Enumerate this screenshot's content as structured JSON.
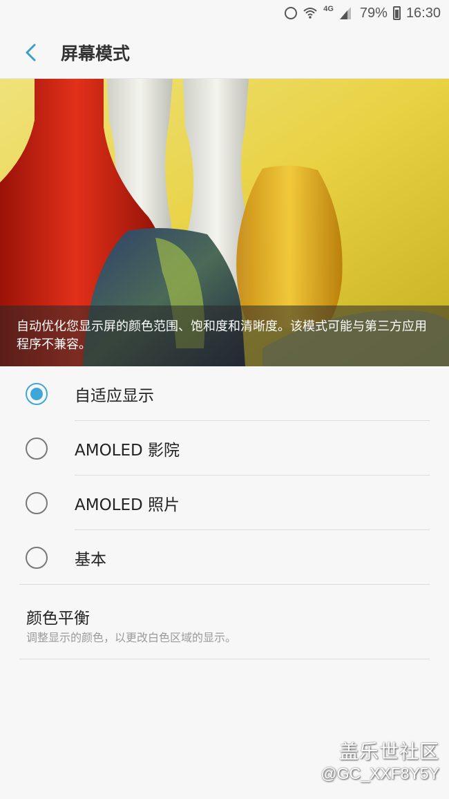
{
  "status_bar": {
    "network": "4G",
    "battery": "79%",
    "time": "16:30"
  },
  "app_bar": {
    "title": "屏幕模式"
  },
  "preview": {
    "description": "自动优化您显示屏的颜色范围、饱和度和清晰度。该模式可能与第三方应用程序不兼容。"
  },
  "options": [
    {
      "label": "自适应显示",
      "selected": true
    },
    {
      "label": "AMOLED 影院",
      "selected": false
    },
    {
      "label": "AMOLED 照片",
      "selected": false
    },
    {
      "label": "基本",
      "selected": false
    }
  ],
  "color_balance": {
    "title": "颜色平衡",
    "subtitle": "调整显示的颜色，以更改白色区域的显示。"
  },
  "watermark": {
    "title": "盖乐世社区",
    "user": "@GC_XXF8Y5Y"
  },
  "colors": {
    "accent": "#3ea7d8",
    "background": "#f7f7f7"
  }
}
